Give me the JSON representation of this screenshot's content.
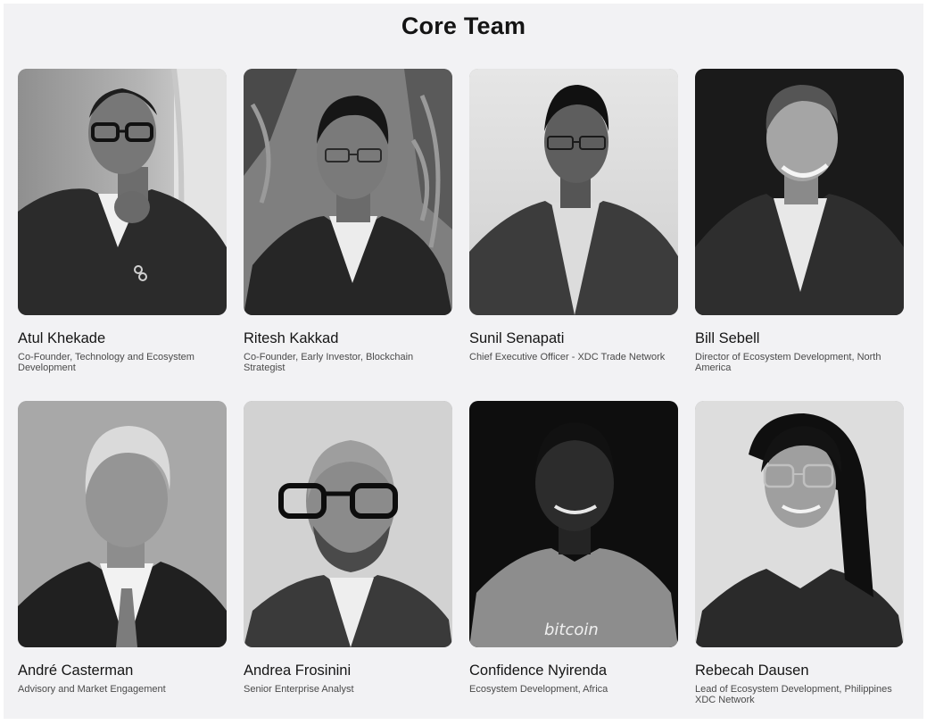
{
  "section": {
    "title": "Core Team"
  },
  "members": [
    {
      "name": "Atul Khekade",
      "role": "Co-Founder, Technology and Ecosystem Development"
    },
    {
      "name": "Ritesh Kakkad",
      "role": "Co-Founder, Early Investor, Blockchain Strategist"
    },
    {
      "name": "Sunil Senapati",
      "role": "Chief Executive Officer - XDC Trade Network"
    },
    {
      "name": "Bill Sebell",
      "role": "Director of Ecosystem Development, North America"
    },
    {
      "name": "André Casterman",
      "role": "Advisory and Market Engagement"
    },
    {
      "name": "Andrea Frosinini",
      "role": "Senior Enterprise Analyst"
    },
    {
      "name": "Confidence Nyirenda",
      "role": "Ecosystem Development, Africa"
    },
    {
      "name": "Rebecah Dausen",
      "role": "Lead of Ecosystem Development, Philippines XDC Network"
    }
  ],
  "shirt_text": "bitcoin",
  "colors": {
    "page_background": "#f2f2f4",
    "title_text": "#141414",
    "role_text": "#4a4a4a"
  }
}
